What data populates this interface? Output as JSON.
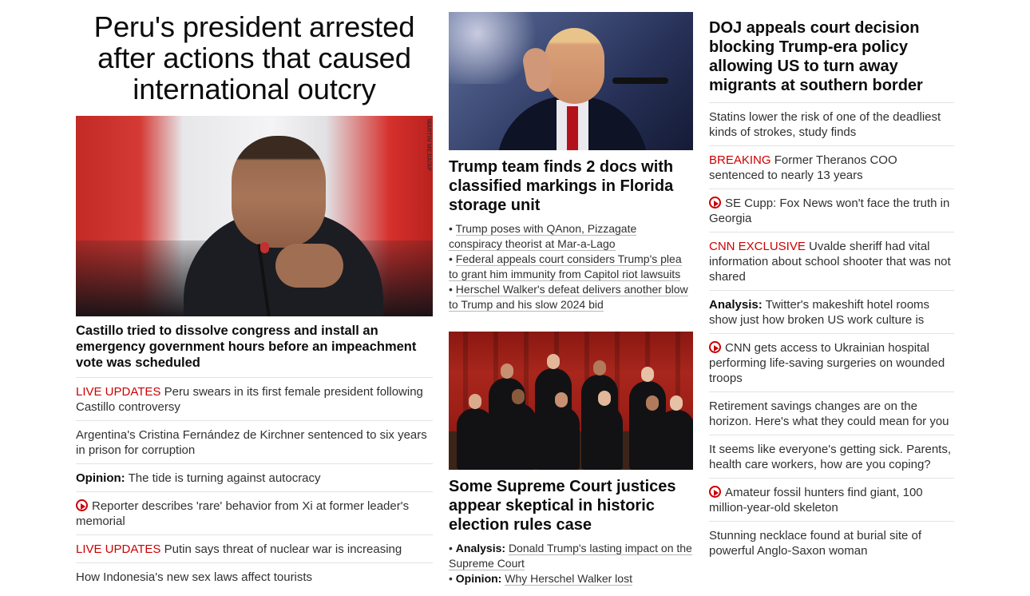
{
  "lead": {
    "headline": "Peru's president arrested after actions that caused international outcry",
    "image_alt": "Pedro Castillo at a press conference",
    "photo_credit": "MARTIN MEJIA/AP",
    "caption": "Castillo tried to dissolve congress and install an emergency government hours before an impeachment vote was scheduled",
    "stories": [
      {
        "tag": "LIVE UPDATES",
        "tag_style": "red",
        "text": "Peru swears in its first female president following Castillo controversy"
      },
      {
        "tag": "",
        "tag_style": "",
        "text": "Argentina's Cristina Fernández de Kirchner sentenced to six years in prison for corruption"
      },
      {
        "tag": "Opinion:",
        "tag_style": "bold",
        "text": "The tide is turning against autocracy"
      },
      {
        "tag": "",
        "tag_style": "video",
        "text": "Reporter describes 'rare' behavior from Xi at former leader's memorial"
      },
      {
        "tag": "LIVE UPDATES",
        "tag_style": "red",
        "text": "Putin says threat of nuclear war is increasing"
      },
      {
        "tag": "",
        "tag_style": "",
        "text": "How Indonesia's new sex laws affect tourists"
      }
    ]
  },
  "middle": {
    "card1": {
      "title": "Trump team finds 2 docs with classified markings in Florida storage unit",
      "bullets": [
        {
          "prefix": "",
          "text": "Trump poses with QAnon, Pizzagate conspiracy theorist at Mar-a-Lago"
        },
        {
          "prefix": "",
          "text": "Federal appeals court considers Trump's plea to grant him immunity from Capitol riot lawsuits"
        },
        {
          "prefix": "",
          "text": "Herschel Walker's defeat delivers another blow to Trump and his slow 2024 bid"
        }
      ]
    },
    "card2": {
      "title": "Some Supreme Court justices appear skeptical in historic election rules case",
      "bullets": [
        {
          "prefix": "Analysis:",
          "text": "Donald Trump's lasting impact on the Supreme Court"
        },
        {
          "prefix": "Opinion:",
          "text": "Why Herschel Walker lost"
        }
      ]
    }
  },
  "right": {
    "headline": "DOJ appeals court decision blocking Trump-era policy allowing US to turn away migrants at southern border",
    "stories": [
      {
        "tag": "",
        "tag_style": "",
        "text": "Statins lower the risk of one of the deadliest kinds of strokes, study finds"
      },
      {
        "tag": "BREAKING",
        "tag_style": "red",
        "text": "Former Theranos COO sentenced to nearly 13 years"
      },
      {
        "tag": "",
        "tag_style": "video",
        "text": "SE Cupp: Fox News won't face the truth in Georgia"
      },
      {
        "tag": "CNN EXCLUSIVE",
        "tag_style": "red",
        "text": "Uvalde sheriff had vital information about school shooter that was not shared"
      },
      {
        "tag": "Analysis:",
        "tag_style": "bold",
        "text": "Twitter's makeshift hotel rooms show just how broken US work culture is"
      },
      {
        "tag": "",
        "tag_style": "video",
        "text": "CNN gets access to Ukrainian hospital performing life-saving surgeries on wounded troops"
      },
      {
        "tag": "",
        "tag_style": "",
        "text": "Retirement savings changes are on the horizon. Here's what they could mean for you"
      },
      {
        "tag": "",
        "tag_style": "",
        "text": "It seems like everyone's getting sick. Parents, health care workers, how are you coping?"
      },
      {
        "tag": "",
        "tag_style": "video",
        "text": "Amateur fossil hunters find giant, 100 million-year-old skeleton"
      },
      {
        "tag": "",
        "tag_style": "",
        "text": "Stunning necklace found at burial site of powerful Anglo-Saxon woman"
      }
    ]
  },
  "colors": {
    "accent_red": "#cc0000",
    "text": "#0c0c0c",
    "divider": "#e3e3e3"
  }
}
